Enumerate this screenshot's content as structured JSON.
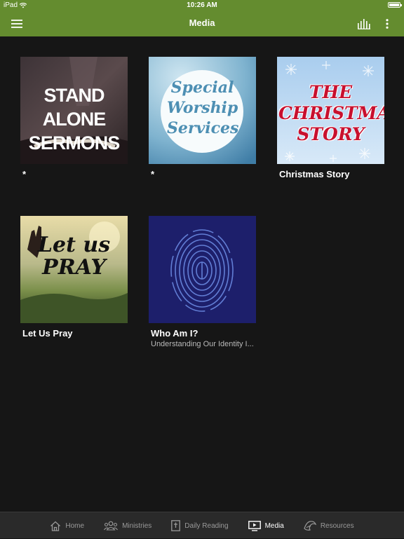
{
  "status": {
    "carrier": "iPad",
    "time": "10:26 AM"
  },
  "header": {
    "title": "Media"
  },
  "items": [
    {
      "art_text": "STAND ALONE SERMONS",
      "title": "*",
      "subtitle": ""
    },
    {
      "art_text": "Special Worship Services",
      "title": "*",
      "subtitle": ""
    },
    {
      "art_text": "THE CHRISTMAS STORY",
      "title": "Christmas Story",
      "subtitle": ""
    },
    {
      "art_text": "Let us PRAY",
      "title": "Let Us Pray",
      "subtitle": ""
    },
    {
      "art_text": "",
      "title": "Who Am I?",
      "subtitle": "Understanding Our Identity I..."
    }
  ],
  "tabs": [
    {
      "label": "Home",
      "icon": "home-icon",
      "active": false
    },
    {
      "label": "Ministries",
      "icon": "people-icon",
      "active": false
    },
    {
      "label": "Daily Reading",
      "icon": "bible-icon",
      "active": false
    },
    {
      "label": "Media",
      "icon": "media-icon",
      "active": true
    },
    {
      "label": "Resources",
      "icon": "resources-icon",
      "active": false
    }
  ],
  "colors": {
    "accent": "#648c2f",
    "background": "#161616",
    "tabbar": "#2a2a2a"
  }
}
